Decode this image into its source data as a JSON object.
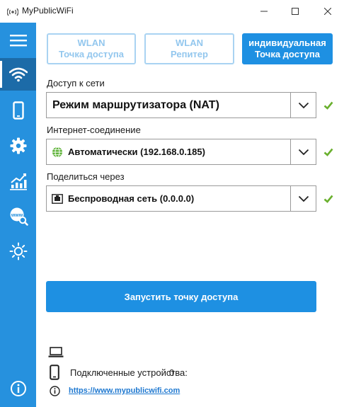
{
  "window": {
    "title": "MyPublicWiFi"
  },
  "sidebar": {
    "items": [
      {
        "icon": "menu-icon"
      },
      {
        "icon": "wifi-icon",
        "active": true
      },
      {
        "icon": "phone-icon"
      },
      {
        "icon": "gear-icon"
      },
      {
        "icon": "stats-icon"
      },
      {
        "icon": "www-search-icon"
      },
      {
        "icon": "brightness-icon"
      },
      {
        "icon": "info-icon"
      }
    ]
  },
  "modes": [
    {
      "line1": "WLAN",
      "line2": "Точка доступа",
      "selected": false
    },
    {
      "line1": "WLAN",
      "line2": "Репитер",
      "selected": false
    },
    {
      "line1": "индивидуальная",
      "line2": "Точка доступа",
      "selected": true
    }
  ],
  "network_access": {
    "label": "Доступ к сети",
    "value": "Режим маршрутизатора (NAT)"
  },
  "internet_connection": {
    "label": "Интернет-соединение",
    "value": "Автоматически (192.168.0.185)"
  },
  "share_via": {
    "label": "Поделиться через",
    "value": "Беспроводная сеть (0.0.0.0)"
  },
  "start_button": {
    "label": "Запустить точку доступа"
  },
  "connected_devices": {
    "label": "Подключенные устройства:",
    "count": "0"
  },
  "website": {
    "url": "https://www.mypublicwifi.com"
  },
  "colors": {
    "accent": "#1e90e2",
    "sidebar": "#2691de",
    "sidebar_active": "#1c6ba8",
    "check": "#6ab02e"
  }
}
